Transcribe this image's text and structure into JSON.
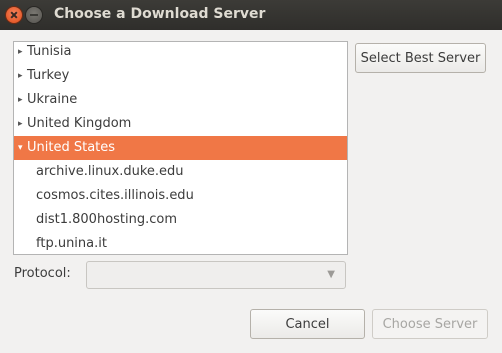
{
  "window": {
    "title": "Choose a Download Server"
  },
  "tree": {
    "rows": [
      {
        "label": "Tunisia",
        "arrow": "▸"
      },
      {
        "label": "Turkey",
        "arrow": "▸"
      },
      {
        "label": "Ukraine",
        "arrow": "▸"
      },
      {
        "label": "United Kingdom",
        "arrow": "▸"
      },
      {
        "label": "United States",
        "arrow": "▾"
      },
      {
        "label": "archive.linux.duke.edu"
      },
      {
        "label": "cosmos.cites.illinois.edu"
      },
      {
        "label": "dist1.800hosting.com"
      },
      {
        "label": "ftp.unina.it"
      }
    ],
    "selected_index": 4
  },
  "buttons": {
    "best_server": "Select Best Server",
    "cancel": "Cancel",
    "choose": "Choose Server"
  },
  "protocol": {
    "label": "Protocol:",
    "value": "",
    "caret": "▼"
  },
  "colors": {
    "selection": "#f07746",
    "titlebar": "#3c3b37"
  }
}
